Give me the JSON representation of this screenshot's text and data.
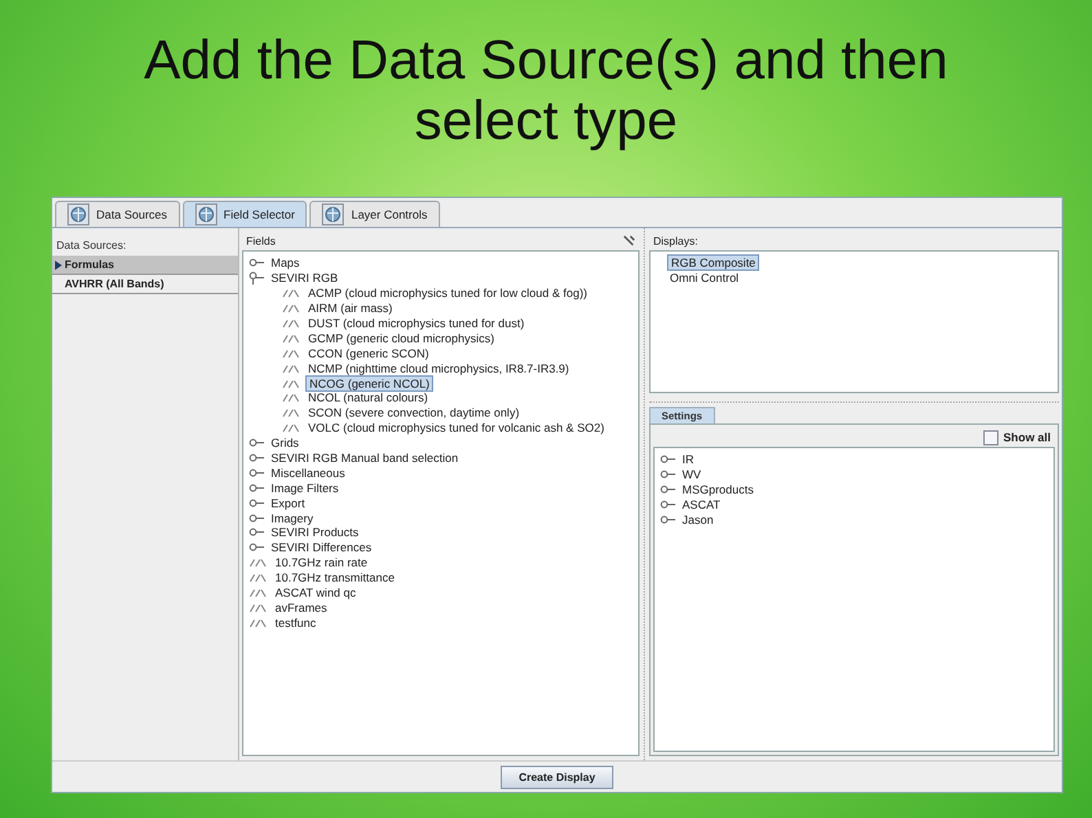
{
  "slide_title": "Add the Data Source(s) and then select type",
  "tabs": [
    {
      "label": "Data Sources",
      "selected": false
    },
    {
      "label": "Field Selector",
      "selected": true
    },
    {
      "label": "Layer Controls",
      "selected": false
    }
  ],
  "data_sources": {
    "header": "Data Sources:",
    "items": [
      {
        "label": "Formulas",
        "selected": true
      },
      {
        "label": "AVHRR (All Bands)",
        "selected": false
      }
    ]
  },
  "fields": {
    "header": "Fields",
    "tree": [
      {
        "kind": "folder",
        "label": "Maps",
        "expanded": false,
        "selected": false
      },
      {
        "kind": "folder",
        "label": "SEVIRI RGB",
        "expanded": true,
        "selected": false,
        "children": [
          {
            "kind": "formula",
            "label": "ACMP (cloud microphysics tuned for low cloud & fog))",
            "selected": false
          },
          {
            "kind": "formula",
            "label": "AIRM (air mass)",
            "selected": false
          },
          {
            "kind": "formula",
            "label": "DUST (cloud microphysics tuned for dust)",
            "selected": false
          },
          {
            "kind": "formula",
            "label": "GCMP (generic cloud microphysics)",
            "selected": false
          },
          {
            "kind": "formula",
            "label": "CCON (generic SCON)",
            "selected": false
          },
          {
            "kind": "formula",
            "label": "NCMP (nighttime cloud microphysics, IR8.7-IR3.9)",
            "selected": false
          },
          {
            "kind": "formula",
            "label": "NCOG (generic NCOL)",
            "selected": true
          },
          {
            "kind": "formula",
            "label": "NCOL (natural colours)",
            "selected": false
          },
          {
            "kind": "formula",
            "label": "SCON (severe convection, daytime only)",
            "selected": false
          },
          {
            "kind": "formula",
            "label": "VOLC (cloud microphysics tuned for volcanic ash & SO2)",
            "selected": false
          }
        ]
      },
      {
        "kind": "folder",
        "label": "Grids",
        "expanded": false,
        "selected": false
      },
      {
        "kind": "folder",
        "label": "SEVIRI RGB Manual band selection",
        "expanded": false,
        "selected": false
      },
      {
        "kind": "folder",
        "label": "Miscellaneous",
        "expanded": false,
        "selected": false
      },
      {
        "kind": "folder",
        "label": "Image Filters",
        "expanded": false,
        "selected": false
      },
      {
        "kind": "folder",
        "label": "Export",
        "expanded": false,
        "selected": false
      },
      {
        "kind": "folder",
        "label": "Imagery",
        "expanded": false,
        "selected": false
      },
      {
        "kind": "folder",
        "label": "SEVIRI Products",
        "expanded": false,
        "selected": false
      },
      {
        "kind": "folder",
        "label": "SEVIRI Differences",
        "expanded": false,
        "selected": false
      },
      {
        "kind": "formula",
        "label": "10.7GHz rain rate",
        "selected": false
      },
      {
        "kind": "formula",
        "label": "10.7GHz transmittance",
        "selected": false
      },
      {
        "kind": "formula",
        "label": "ASCAT wind qc",
        "selected": false
      },
      {
        "kind": "formula",
        "label": "avFrames",
        "selected": false
      },
      {
        "kind": "formula",
        "label": "testfunc",
        "selected": false
      }
    ]
  },
  "displays": {
    "header": "Displays:",
    "items": [
      {
        "label": "RGB Composite",
        "selected": true
      },
      {
        "label": "Omni Control",
        "selected": false
      }
    ]
  },
  "settings": {
    "tab": "Settings",
    "show_all": {
      "label": "Show all",
      "checked": false
    },
    "tree": [
      {
        "label": "IR",
        "expanded": false
      },
      {
        "label": "WV",
        "expanded": false
      },
      {
        "label": "MSGproducts",
        "expanded": false
      },
      {
        "label": "ASCAT",
        "expanded": false
      },
      {
        "label": "Jason",
        "expanded": false
      }
    ]
  },
  "button": "Create Display"
}
